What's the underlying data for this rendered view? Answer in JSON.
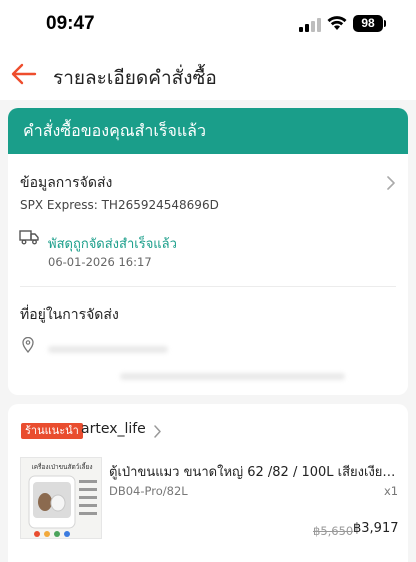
{
  "status_bar": {
    "time": "09:47",
    "battery": "98"
  },
  "header": {
    "title": "รายละเอียดคำสั่งซื้อ"
  },
  "order_status": {
    "banner": "คำสั่งซื้อของคุณสำเร็จแล้ว",
    "color": "#1a9e8a"
  },
  "shipping": {
    "title": "ข้อมูลการจัดส่ง",
    "tracking": "SPX Express: TH265924548696D",
    "status": "พัสดุถูกจัดส่งสำเร็จแล้ว",
    "timestamp": "06-01-2026 16:17"
  },
  "address": {
    "title": "ที่อยู่ในการจัดส่ง"
  },
  "shop": {
    "badge": "ร้านแนะนำ",
    "name": "artex_life",
    "accent": "#e94d2f"
  },
  "product": {
    "name": "ตู้เป่าขนแมว ขนาดใหญ่ 62 /82 / 100L เสียงเงียบ...",
    "variant": "DB04-Pro/82L",
    "quantity": "x1",
    "price_original": "฿5,650",
    "price_final": "฿3,917",
    "image_text": "เครื่องเป่าขนสัตว์เลี้ยง"
  }
}
